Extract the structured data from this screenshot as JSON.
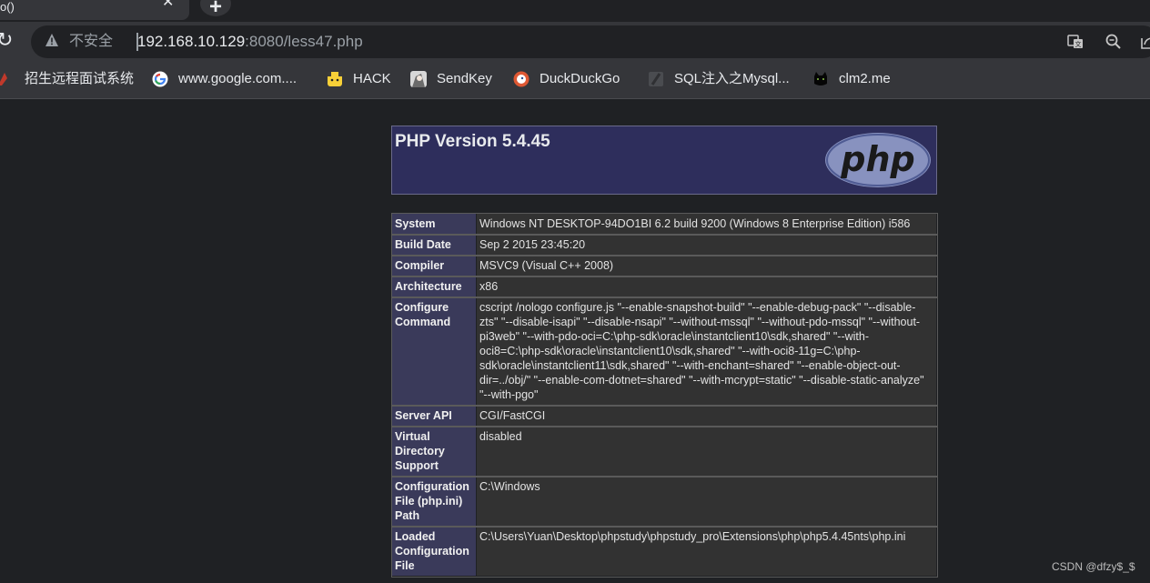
{
  "browser": {
    "tab_title": "o()",
    "tab_close": "✕",
    "new_tab": "+",
    "insecure_label": "不安全",
    "url_host": "192.168.10.129",
    "url_rest": ":8080/less47.php"
  },
  "bookmarks": [
    {
      "label": "招生远程面试系统",
      "icon": "red-flag-icon"
    },
    {
      "label": "www.google.com....",
      "icon": "google-icon"
    },
    {
      "label": "HACK",
      "icon": "pikachu-icon"
    },
    {
      "label": "SendKey",
      "icon": "anime-avatar-icon"
    },
    {
      "label": "DuckDuckGo",
      "icon": "duck-icon"
    },
    {
      "label": "SQL注入之Mysql...",
      "icon": "slash-page-icon"
    },
    {
      "label": "clm2.me",
      "icon": "black-cat-icon"
    }
  ],
  "phpinfo": {
    "title": "PHP Version 5.4.45",
    "logo_text": "php",
    "rows": [
      {
        "key": "System",
        "value": "Windows NT DESKTOP-94DO1BI 6.2 build 9200 (Windows 8 Enterprise Edition) i586"
      },
      {
        "key": "Build Date",
        "value": "Sep 2 2015 23:45:20"
      },
      {
        "key": "Compiler",
        "value": "MSVC9 (Visual C++ 2008)"
      },
      {
        "key": "Architecture",
        "value": "x86"
      },
      {
        "key": "Configure Command",
        "value": "cscript /nologo configure.js \"--enable-snapshot-build\" \"--enable-debug-pack\" \"--disable-zts\" \"--disable-isapi\" \"--disable-nsapi\" \"--without-mssql\" \"--without-pdo-mssql\" \"--without-pi3web\" \"--with-pdo-oci=C:\\php-sdk\\oracle\\instantclient10\\sdk,shared\" \"--with-oci8=C:\\php-sdk\\oracle\\instantclient10\\sdk,shared\" \"--with-oci8-11g=C:\\php-sdk\\oracle\\instantclient11\\sdk,shared\" \"--with-enchant=shared\" \"--enable-object-out-dir=../obj/\" \"--enable-com-dotnet=shared\" \"--with-mcrypt=static\" \"--disable-static-analyze\" \"--with-pgo\""
      },
      {
        "key": "Server API",
        "value": "CGI/FastCGI"
      },
      {
        "key": "Virtual Directory Support",
        "value": "disabled"
      },
      {
        "key": "Configuration File (php.ini) Path",
        "value": "C:\\Windows"
      },
      {
        "key": "Loaded Configuration File",
        "value": "C:\\Users\\Yuan\\Desktop\\phpstudy\\phpstudy_pro\\Extensions\\php\\php5.4.45nts\\php.ini"
      }
    ]
  },
  "watermark": "CSDN @dfzy$_$"
}
